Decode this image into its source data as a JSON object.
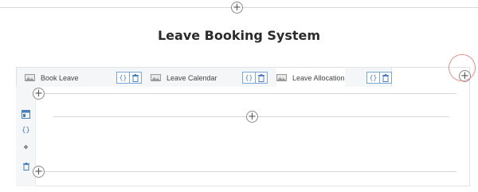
{
  "page": {
    "title": "Leave Booking System"
  },
  "tabs": [
    {
      "label": "Book Leave"
    },
    {
      "label": "Leave Calendar"
    },
    {
      "label": "Leave Allocation"
    }
  ],
  "tools": {
    "code_glyph": "{}",
    "delete_glyph": "🗑"
  },
  "rail": {
    "settings_glyph": "⚙",
    "code_glyph": "{}",
    "move_glyph": "✥",
    "delete_glyph": "🗑"
  },
  "add_glyph": "+"
}
